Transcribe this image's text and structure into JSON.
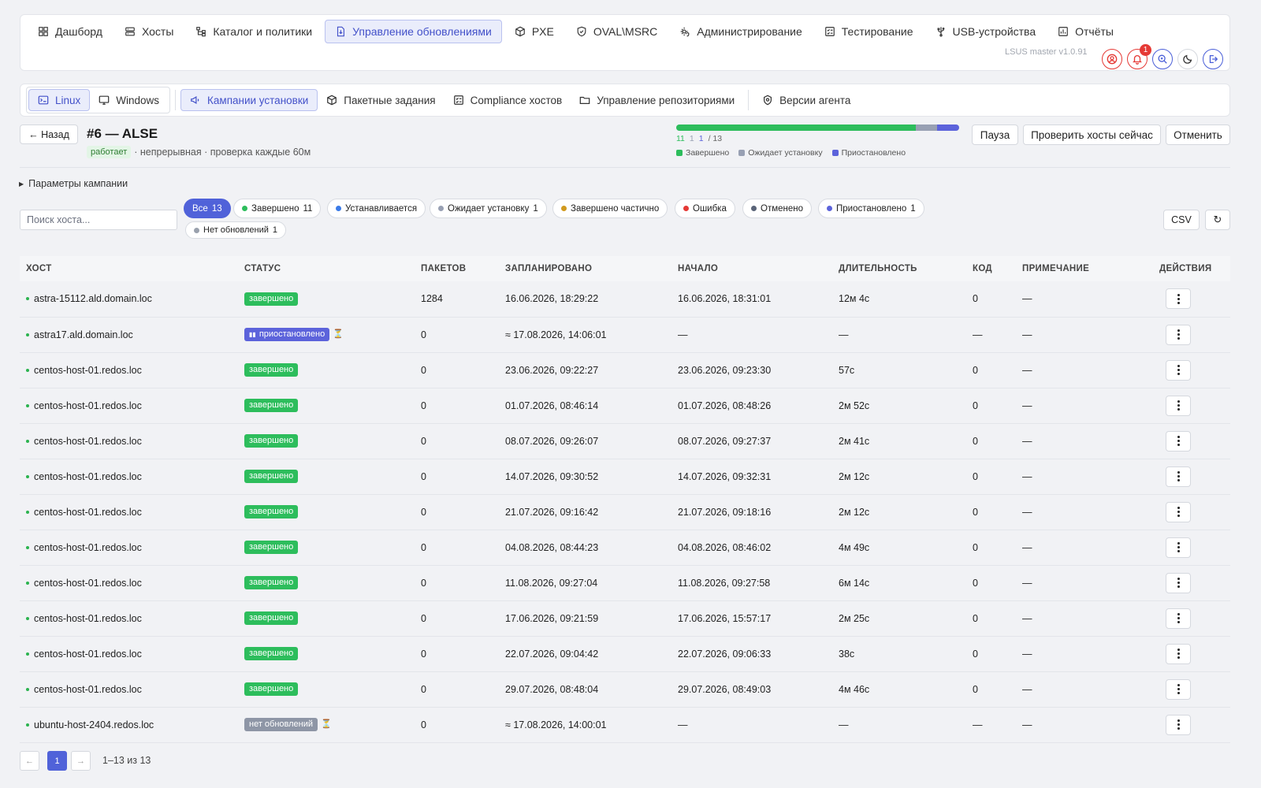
{
  "topnav": {
    "items": [
      {
        "label": "Дашборд",
        "icon": "dashboard-icon"
      },
      {
        "label": "Хосты",
        "icon": "server-icon"
      },
      {
        "label": "Каталог и политики",
        "icon": "tree-icon"
      },
      {
        "label": "Управление обновлениями",
        "icon": "update-file-icon"
      },
      {
        "label": "PXE",
        "icon": "cube-icon"
      },
      {
        "label": "OVAL\\MSRC",
        "icon": "shield-icon"
      },
      {
        "label": "Администрирование",
        "icon": "gear-shield-icon"
      },
      {
        "label": "Тестирование",
        "icon": "checklist-icon"
      },
      {
        "label": "USB-устройства",
        "icon": "usb-icon"
      },
      {
        "label": "Отчёты",
        "icon": "report-icon"
      }
    ],
    "version": "LSUS master v1.0.91",
    "notifications_count": "1"
  },
  "subnav": {
    "os": [
      {
        "label": "Linux",
        "icon": "terminal-icon"
      },
      {
        "label": "Windows",
        "icon": "monitor-icon"
      }
    ],
    "items": [
      {
        "label": "Кампании установки",
        "icon": "megaphone-icon"
      },
      {
        "label": "Пакетные задания",
        "icon": "cube-icon"
      },
      {
        "label": "Compliance хостов",
        "icon": "checklist-icon"
      },
      {
        "label": "Управление репозиториями",
        "icon": "folder-icon"
      },
      {
        "label": "Версии агента",
        "icon": "agent-icon"
      }
    ]
  },
  "campaign": {
    "back_label": "← Назад",
    "title": "#6 — ALSE",
    "status": "работает",
    "meta": "· непрерывная · проверка каждые 60м",
    "progress": {
      "total": 13,
      "done": 11,
      "waiting": 1,
      "paused": 1,
      "done_label": "11",
      "waiting_label": "1",
      "paused_label": "1",
      "total_label": "/ 13",
      "legend": {
        "done": "Завершено",
        "waiting": "Ожидает установку",
        "paused": "Приостановлено"
      }
    },
    "buttons": {
      "pause": "Пауза",
      "check": "Проверить хосты сейчас",
      "cancel": "Отменить"
    },
    "params_label": "Параметры кампании"
  },
  "colors": {
    "done": "#2dbd5c",
    "waiting": "#98a0b3",
    "paused": "#5c63db",
    "installing": "#3b7be8",
    "partial": "#d19a1e",
    "error": "#e53935",
    "canceled": "#5a6478",
    "noupd": "#9aa1ad"
  },
  "filters": {
    "search_placeholder": "Поиск хоста...",
    "chips": [
      {
        "label": "Все",
        "count": "13"
      },
      {
        "label": "Завершено",
        "count": "11"
      },
      {
        "label": "Устанавливается",
        "count": ""
      },
      {
        "label": "Ожидает установку",
        "count": "1"
      },
      {
        "label": "Завершено частично",
        "count": ""
      },
      {
        "label": "Ошибка",
        "count": ""
      },
      {
        "label": "Отменено",
        "count": ""
      },
      {
        "label": "Приостановлено",
        "count": "1"
      },
      {
        "label": "Нет обновлений",
        "count": "1"
      }
    ],
    "csv_label": "CSV",
    "refresh_label": "↻"
  },
  "table": {
    "headers": {
      "host": "ХОСТ",
      "status": "СТАТУС",
      "packages": "ПАКЕТОВ",
      "scheduled": "ЗАПЛАНИРОВАНО",
      "start": "НАЧАЛО",
      "duration": "ДЛИТЕЛЬНОСТЬ",
      "code": "КОД",
      "note": "ПРИМЕЧАНИЕ",
      "actions": "ДЕЙСТВИЯ"
    },
    "rows": [
      {
        "host": "astra-15112.ald.domain.loc",
        "status": "завершено",
        "packages": "1284",
        "scheduled": "16.06.2026, 18:29:22",
        "start": "16.06.2026, 18:31:01",
        "duration": "12м 4с",
        "code": "0",
        "note": "—"
      },
      {
        "host": "astra17.ald.domain.loc",
        "status": "приостановлено",
        "packages": "0",
        "scheduled": "≈ 17.08.2026, 14:06:01",
        "start": "—",
        "duration": "—",
        "code": "—",
        "note": "—"
      },
      {
        "host": "centos-host-01.redos.loc",
        "status": "завершено",
        "packages": "0",
        "scheduled": "23.06.2026, 09:22:27",
        "start": "23.06.2026, 09:23:30",
        "duration": "57с",
        "code": "0",
        "note": "—"
      },
      {
        "host": "centos-host-01.redos.loc",
        "status": "завершено",
        "packages": "0",
        "scheduled": "01.07.2026, 08:46:14",
        "start": "01.07.2026, 08:48:26",
        "duration": "2м 52с",
        "code": "0",
        "note": "—"
      },
      {
        "host": "centos-host-01.redos.loc",
        "status": "завершено",
        "packages": "0",
        "scheduled": "08.07.2026, 09:26:07",
        "start": "08.07.2026, 09:27:37",
        "duration": "2м 41с",
        "code": "0",
        "note": "—"
      },
      {
        "host": "centos-host-01.redos.loc",
        "status": "завершено",
        "packages": "0",
        "scheduled": "14.07.2026, 09:30:52",
        "start": "14.07.2026, 09:32:31",
        "duration": "2м 12с",
        "code": "0",
        "note": "—"
      },
      {
        "host": "centos-host-01.redos.loc",
        "status": "завершено",
        "packages": "0",
        "scheduled": "21.07.2026, 09:16:42",
        "start": "21.07.2026, 09:18:16",
        "duration": "2м 12с",
        "code": "0",
        "note": "—"
      },
      {
        "host": "centos-host-01.redos.loc",
        "status": "завершено",
        "packages": "0",
        "scheduled": "04.08.2026, 08:44:23",
        "start": "04.08.2026, 08:46:02",
        "duration": "4м 49с",
        "code": "0",
        "note": "—"
      },
      {
        "host": "centos-host-01.redos.loc",
        "status": "завершено",
        "packages": "0",
        "scheduled": "11.08.2026, 09:27:04",
        "start": "11.08.2026, 09:27:58",
        "duration": "6м 14с",
        "code": "0",
        "note": "—"
      },
      {
        "host": "centos-host-01.redos.loc",
        "status": "завершено",
        "packages": "0",
        "scheduled": "17.06.2026, 09:21:59",
        "start": "17.06.2026, 15:57:17",
        "duration": "2м 25с",
        "code": "0",
        "note": "—"
      },
      {
        "host": "centos-host-01.redos.loc",
        "status": "завершено",
        "packages": "0",
        "scheduled": "22.07.2026, 09:04:42",
        "start": "22.07.2026, 09:06:33",
        "duration": "38с",
        "code": "0",
        "note": "—"
      },
      {
        "host": "centos-host-01.redos.loc",
        "status": "завершено",
        "packages": "0",
        "scheduled": "29.07.2026, 08:48:04",
        "start": "29.07.2026, 08:49:03",
        "duration": "4м 46с",
        "code": "0",
        "note": "—"
      },
      {
        "host": "ubuntu-host-2404.redos.loc",
        "status": "нет обновлений",
        "packages": "0",
        "scheduled": "≈ 17.08.2026, 14:00:01",
        "start": "—",
        "duration": "—",
        "code": "—",
        "note": "—"
      }
    ]
  },
  "pagination": {
    "prev": "←",
    "page": "1",
    "next": "→",
    "info": "1–13 из 13"
  }
}
